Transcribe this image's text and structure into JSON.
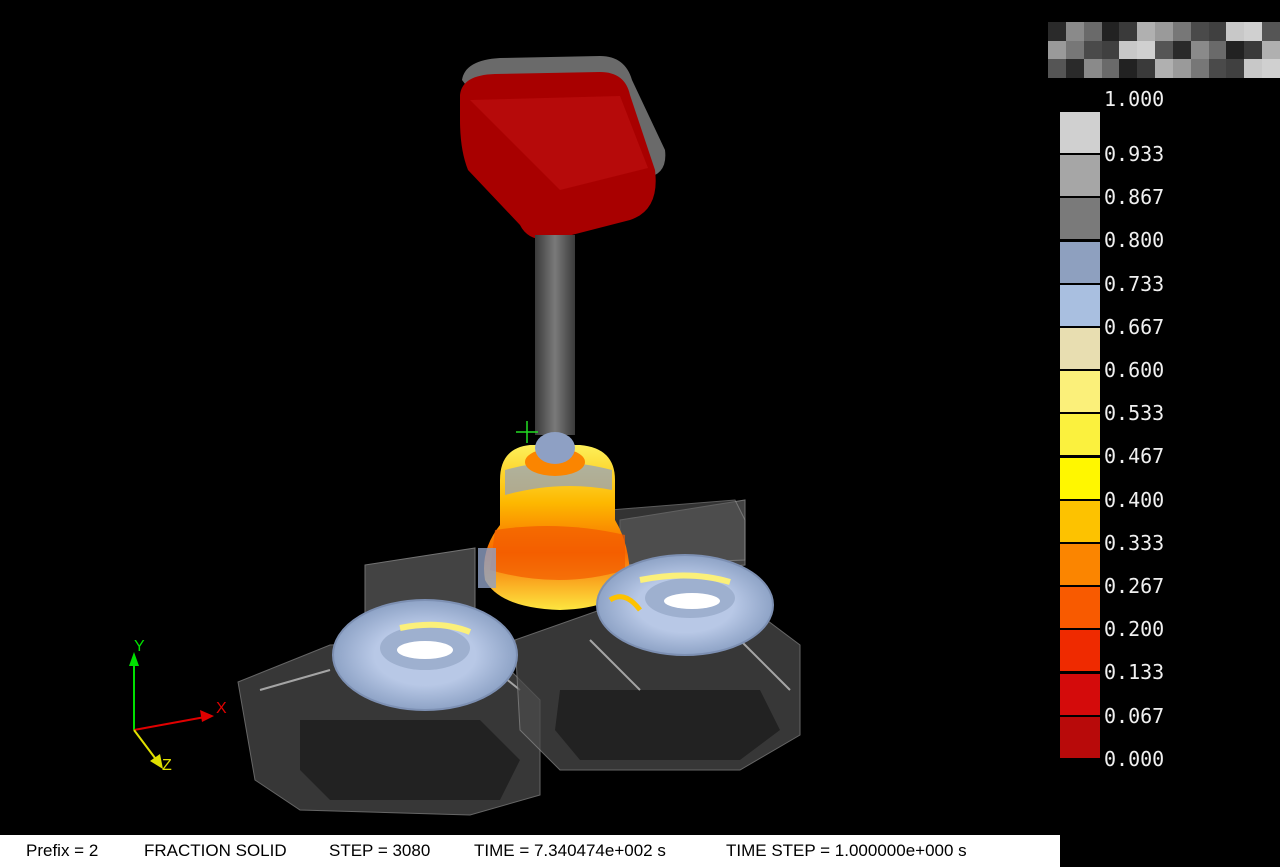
{
  "legend": {
    "top_label": "1.000",
    "rows": [
      {
        "label": "0.933",
        "color": "#d0d0d0"
      },
      {
        "label": "0.867",
        "color": "#a6a6a6"
      },
      {
        "label": "0.800",
        "color": "#7a7a7a"
      },
      {
        "label": "0.733",
        "color": "#8ea0bf"
      },
      {
        "label": "0.667",
        "color": "#a9bfe0"
      },
      {
        "label": "0.600",
        "color": "#e8deb1"
      },
      {
        "label": "0.533",
        "color": "#fbf07a"
      },
      {
        "label": "0.467",
        "color": "#fbf13e"
      },
      {
        "label": "0.400",
        "color": "#fff700"
      },
      {
        "label": "0.333",
        "color": "#fdc200"
      },
      {
        "label": "0.267",
        "color": "#fb8500"
      },
      {
        "label": "0.200",
        "color": "#f85a00"
      },
      {
        "label": "0.133",
        "color": "#ef2a00"
      },
      {
        "label": "0.067",
        "color": "#d40b0b"
      },
      {
        "label": "0.000",
        "color": "#b80a0a"
      }
    ]
  },
  "axes": {
    "x_label": "X",
    "y_label": "Y",
    "z_label": "Z"
  },
  "status": {
    "prefix": "Prefix = 2",
    "variable": "FRACTION SOLID",
    "step": "STEP = 3080",
    "time": "TIME = 7.340474e+002 s",
    "time_step": "TIME STEP = 1.000000e+000 s"
  }
}
